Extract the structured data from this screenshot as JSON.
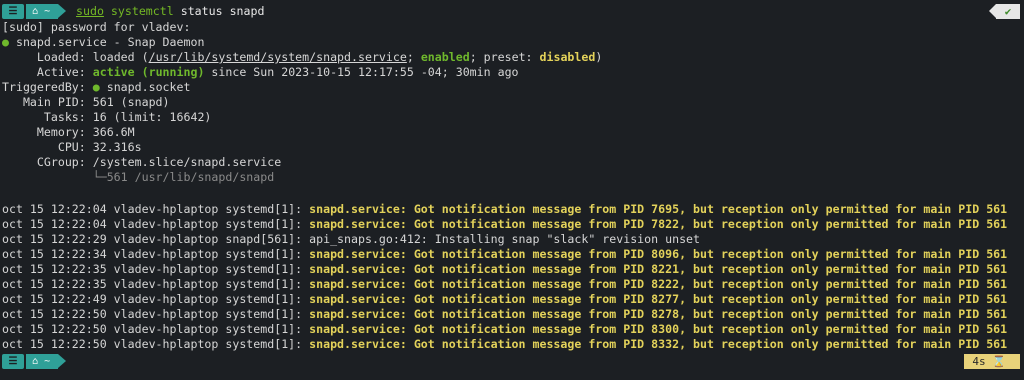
{
  "prompt_top": {
    "os_icon": "linux-distro-icon",
    "dir_icon": "home-icon",
    "dir": "~",
    "sudo": "sudo",
    "systemctl": "systemctl",
    "args": " status snapd",
    "status_icon": "checkmark-icon",
    "status_text": "✔"
  },
  "password_prompt": "[sudo] password for vladev:",
  "service": {
    "bullet": "●",
    "title": " snapd.service - Snap Daemon",
    "loaded_label": "     Loaded: ",
    "loaded_pre": "loaded (",
    "loaded_path": "/usr/lib/systemd/system/snapd.service",
    "loaded_sep": "; ",
    "loaded_enabled": "enabled",
    "loaded_mid": "; preset: ",
    "loaded_preset": "disabled",
    "loaded_end": ")",
    "active_label": "     Active: ",
    "active_state": "active (running)",
    "active_rest": " since Sun 2023-10-15 12:17:55 -04; 30min ago",
    "triggered_label": "TriggeredBy: ",
    "triggered_bullet": "●",
    "triggered_value": " snapd.socket",
    "mainpid": "   Main PID: 561 (snapd)",
    "tasks": "      Tasks: 16 (limit: 16642)",
    "memory": "     Memory: 366.6M",
    "cpu": "        CPU: 32.316s",
    "cgroup": "     CGroup: /system.slice/snapd.service",
    "cgroup_child": "             └─561 /usr/lib/snapd/snapd"
  },
  "logs": [
    {
      "prefix": "oct 15 12:22:04 vladev-hplaptop systemd[1]: ",
      "msg": "snapd.service: Got notification message from PID 7695, but reception only permitted for main PID 561",
      "hl": true
    },
    {
      "prefix": "oct 15 12:22:04 vladev-hplaptop systemd[1]: ",
      "msg": "snapd.service: Got notification message from PID 7822, but reception only permitted for main PID 561",
      "hl": true
    },
    {
      "prefix": "oct 15 12:22:29 vladev-hplaptop snapd[561]: ",
      "msg": "api_snaps.go:412: Installing snap \"slack\" revision unset",
      "hl": false
    },
    {
      "prefix": "oct 15 12:22:34 vladev-hplaptop systemd[1]: ",
      "msg": "snapd.service: Got notification message from PID 8096, but reception only permitted for main PID 561",
      "hl": true
    },
    {
      "prefix": "oct 15 12:22:35 vladev-hplaptop systemd[1]: ",
      "msg": "snapd.service: Got notification message from PID 8221, but reception only permitted for main PID 561",
      "hl": true
    },
    {
      "prefix": "oct 15 12:22:35 vladev-hplaptop systemd[1]: ",
      "msg": "snapd.service: Got notification message from PID 8222, but reception only permitted for main PID 561",
      "hl": true
    },
    {
      "prefix": "oct 15 12:22:49 vladev-hplaptop systemd[1]: ",
      "msg": "snapd.service: Got notification message from PID 8277, but reception only permitted for main PID 561",
      "hl": true
    },
    {
      "prefix": "oct 15 12:22:50 vladev-hplaptop systemd[1]: ",
      "msg": "snapd.service: Got notification message from PID 8278, but reception only permitted for main PID 561",
      "hl": true
    },
    {
      "prefix": "oct 15 12:22:50 vladev-hplaptop systemd[1]: ",
      "msg": "snapd.service: Got notification message from PID 8300, but reception only permitted for main PID 561",
      "hl": true
    },
    {
      "prefix": "oct 15 12:22:50 vladev-hplaptop systemd[1]: ",
      "msg": "snapd.service: Got notification message from PID 8332, but reception only permitted for main PID 561",
      "hl": true
    }
  ],
  "prompt_bottom": {
    "os_icon": "linux-distro-icon",
    "dir_icon": "home-icon",
    "dir": "~",
    "duration": "4s",
    "hourglass_icon": "hourglass-icon",
    "hourglass": "⌛"
  },
  "colors": {
    "background": "#1c1f23",
    "segment": "#2fa098",
    "ok": "#6fb82c",
    "warn": "#e3d25a"
  }
}
